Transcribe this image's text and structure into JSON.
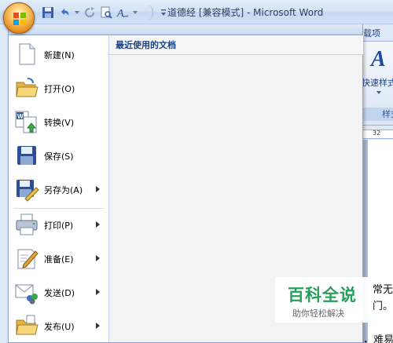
{
  "window": {
    "title": "道德经 [兼容模式] - Microsoft Word"
  },
  "quick_access": {
    "icons": [
      "save-icon",
      "undo-icon",
      "repeat-icon",
      "print-preview-icon",
      "text-style-icon",
      "customize-icon"
    ]
  },
  "ribbon": {
    "tab_partial": "载项",
    "style_label": "快速样式",
    "group_label": "样式",
    "ruler_value": "32"
  },
  "office_menu": {
    "items": [
      {
        "label": "新建(N)",
        "icon": "new-document-icon",
        "submenu": false
      },
      {
        "label": "打开(O)",
        "icon": "open-folder-icon",
        "submenu": false
      },
      {
        "label": "转换(V)",
        "icon": "convert-icon",
        "submenu": false
      },
      {
        "label": "保存(S)",
        "icon": "save-icon",
        "submenu": false
      },
      {
        "label": "另存为(A)",
        "icon": "save-as-icon",
        "submenu": true
      },
      {
        "label": "打印(P)",
        "icon": "printer-icon",
        "submenu": true
      },
      {
        "label": "准备(E)",
        "icon": "prepare-icon",
        "submenu": true
      },
      {
        "label": "发送(D)",
        "icon": "send-icon",
        "submenu": true
      },
      {
        "label": "发布(U)",
        "icon": "publish-icon",
        "submenu": true
      }
    ],
    "recent_header": "最近使用的文档"
  },
  "document": {
    "lines": [
      "常无",
      "门。",
      "，难易"
    ]
  },
  "watermark": {
    "brand": "百科全说",
    "tagline": "助你轻松解决"
  },
  "colors": {
    "accent": "#15428b",
    "menu_border": "#8ba4c8",
    "watermark_green": "#25a05a"
  }
}
